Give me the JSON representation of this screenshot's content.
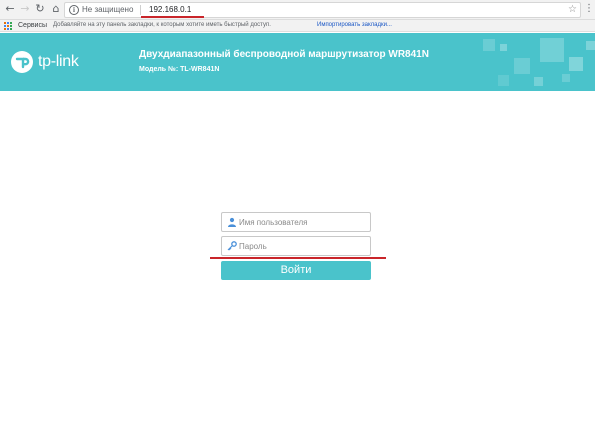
{
  "browser": {
    "back_icon": "back-arrow-icon",
    "forward_icon": "forward-arrow-icon",
    "reload_icon": "reload-icon",
    "home_icon": "home-icon",
    "security_label": "Не защищено",
    "url": "192.168.0.1",
    "star_icon": "star-icon",
    "menu_icon": "kebab-menu-icon"
  },
  "bookmarks": {
    "apps_label": "Сервисы",
    "hint": "Добавляйте на эту панель закладки, к которым хотите иметь быстрый доступ.",
    "import_link": "Импортировать закладки..."
  },
  "header": {
    "logo_text": "tp-link",
    "title": "Двухдиапазонный беспроводной маршрутизатор WR841N",
    "model": "Модель №: TL-WR841N",
    "band_color": "#4ac3cb"
  },
  "login": {
    "username_placeholder": "Имя пользователя",
    "username_icon": "user-icon",
    "password_placeholder": "Пароль",
    "password_icon": "key-icon",
    "submit_label": "Войти",
    "accent_color": "#4ac3cb",
    "highlight_color": "#c9252a"
  }
}
